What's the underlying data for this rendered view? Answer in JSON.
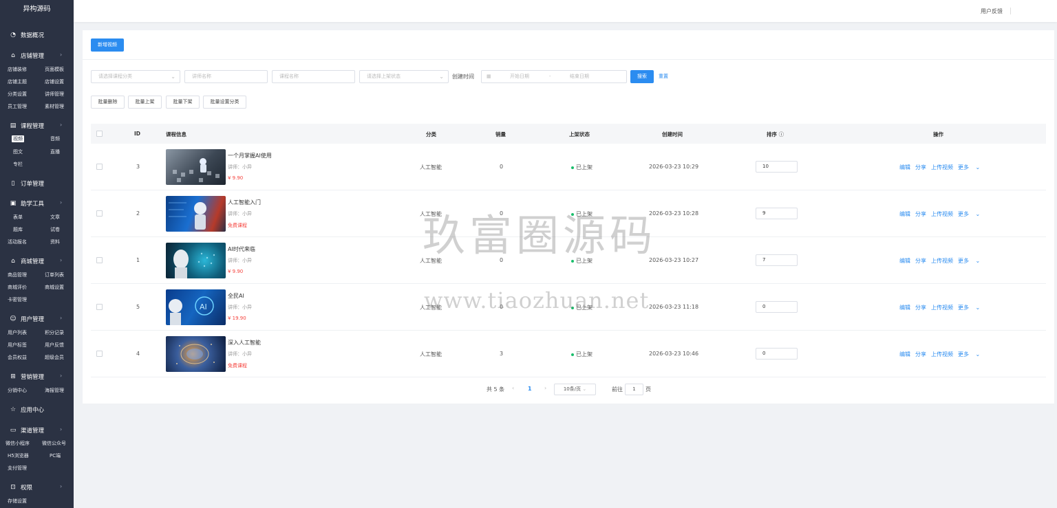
{
  "brand": "异构源码",
  "topbar": {
    "feedback": "用户反馈"
  },
  "sidebar": {
    "dashboard": "数据概况",
    "store": {
      "label": "店铺管理",
      "items": [
        "店铺装修",
        "页面模板",
        "店铺主题",
        "店铺设置",
        "分类设置",
        "讲师管理",
        "员工管理",
        "素材管理"
      ]
    },
    "course": {
      "label": "课程管理",
      "items": [
        "视频",
        "音频",
        "图文",
        "直播",
        "专栏"
      ]
    },
    "orders": "订单管理",
    "tools": {
      "label": "助学工具",
      "items": [
        "表单",
        "文章",
        "题库",
        "试卷",
        "活动报名",
        "资料"
      ]
    },
    "mall": {
      "label": "商城管理",
      "items": [
        "商品管理",
        "订单列表",
        "商城评价",
        "商城设置",
        "卡密管理"
      ]
    },
    "users": {
      "label": "用户管理",
      "items": [
        "用户列表",
        "积分记录",
        "用户标签",
        "用户反馈",
        "会员权益",
        "超级会员"
      ]
    },
    "marketing": {
      "label": "营销管理",
      "items": [
        "分销中心",
        "海报管理"
      ]
    },
    "apps": "应用中心",
    "channels": {
      "label": "渠道管理",
      "items": [
        "微信小程序",
        "微信公众号",
        "H5浏览器",
        "PC端",
        "支付管理"
      ]
    },
    "perm": {
      "label": "权限",
      "items": [
        "存储设置"
      ]
    }
  },
  "toolbar": {
    "add_video": "新增视频",
    "category_ph": "请选择课程分类",
    "lecturer_ph": "讲师名称",
    "course_ph": "课程名称",
    "status_ph": "请选择上架状态",
    "created_label": "创建时间",
    "start_ph": "开始日期",
    "range_sep": "-",
    "end_ph": "结束日期",
    "search": "搜索",
    "reset": "重置",
    "batch_delete": "批量删除",
    "batch_on": "批量上架",
    "batch_off": "批量下架",
    "batch_category": "批量设置分类"
  },
  "table": {
    "headers": {
      "id": "ID",
      "info": "课程信息",
      "category": "分类",
      "sales": "销量",
      "status": "上架状态",
      "created": "创建时间",
      "sort": "排序",
      "ops": "操作"
    },
    "rows": [
      {
        "id": "3",
        "title": "一个月掌握AI使用",
        "lecturer": "讲师：小异",
        "price": "¥ 9.90",
        "category": "人工智能",
        "sales": "0",
        "status": "已上架",
        "created": "2026-03-23 10:29",
        "sort": "10"
      },
      {
        "id": "2",
        "title": "人工智能入门",
        "lecturer": "讲师：小异",
        "price": "免费课程",
        "category": "人工智能",
        "sales": "0",
        "status": "已上架",
        "created": "2026-03-23 10:28",
        "sort": "9"
      },
      {
        "id": "1",
        "title": "AI时代来临",
        "lecturer": "讲师：小异",
        "price": "¥ 9.90",
        "category": "人工智能",
        "sales": "0",
        "status": "已上架",
        "created": "2026-03-23 10:27",
        "sort": "7"
      },
      {
        "id": "5",
        "title": "全民AI",
        "lecturer": "讲师：小异",
        "price": "¥ 19.90",
        "category": "人工智能",
        "sales": "0",
        "status": "已上架",
        "created": "2026-03-23 11:18",
        "sort": "0"
      },
      {
        "id": "4",
        "title": "深入人工智能",
        "lecturer": "讲师：小异",
        "price": "免费课程",
        "category": "人工智能",
        "sales": "3",
        "status": "已上架",
        "created": "2026-03-23 10:46",
        "sort": "0"
      }
    ],
    "ops": {
      "edit": "编辑",
      "share": "分享",
      "upload": "上传视频",
      "more": "更多"
    }
  },
  "pagination": {
    "total": "共 5 条",
    "current": "1",
    "size": "10条/页",
    "goto": "前往",
    "goto_value": "1",
    "page_unit": "页"
  },
  "watermark": {
    "text": "玖富圈源码",
    "url": "www.tiaozhuan.net"
  }
}
